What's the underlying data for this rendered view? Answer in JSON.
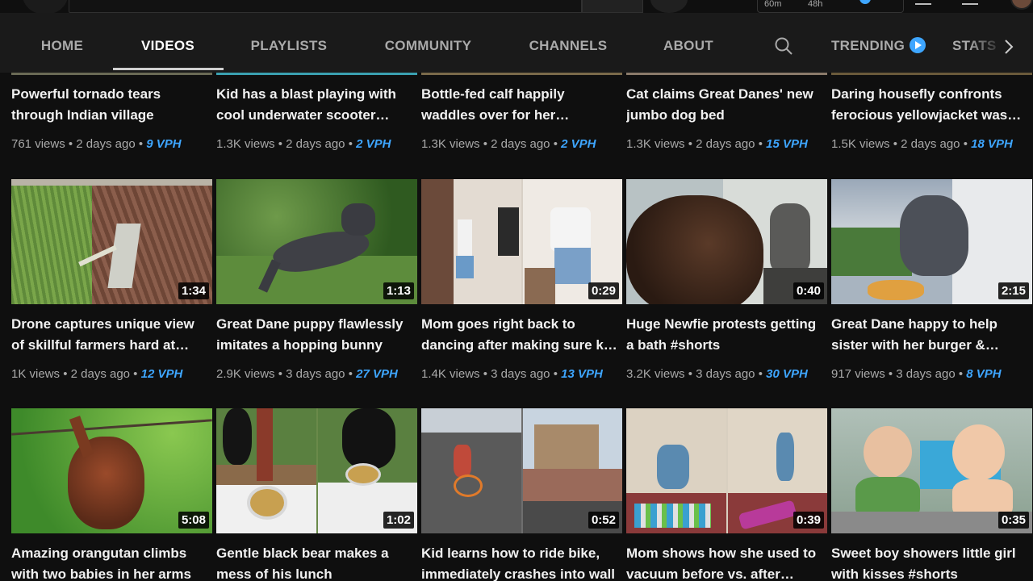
{
  "masthead": {
    "timer_left": "60m",
    "timer_right": "48h"
  },
  "tabs": {
    "items": [
      {
        "label": "HOME"
      },
      {
        "label": "VIDEOS"
      },
      {
        "label": "PLAYLISTS"
      },
      {
        "label": "COMMUNITY"
      },
      {
        "label": "CHANNELS"
      },
      {
        "label": "ABOUT"
      }
    ],
    "active": "VIDEOS",
    "extra": [
      {
        "label": "TRENDING"
      },
      {
        "label": "STATS"
      }
    ]
  },
  "colors": {
    "background": "#0f0f0f",
    "tab_bar": "#1a1a1a",
    "accent_vph": "#3ea6ff",
    "meta_text": "#aaaaaa"
  },
  "rows": [
    {
      "videos": [
        {
          "title1": "Powerful tornado tears",
          "title2": "through Indian village",
          "views": "761 views",
          "age": "2 days ago",
          "vph": "9 VPH"
        },
        {
          "title1": "Kid has a blast playing with",
          "title2": "cool underwater scooter…",
          "views": "1.3K views",
          "age": "2 days ago",
          "vph": "2 VPH"
        },
        {
          "title1": "Bottle-fed calf happily",
          "title2": "waddles over for her…",
          "views": "1.3K views",
          "age": "2 days ago",
          "vph": "2 VPH"
        },
        {
          "title1": "Cat claims Great Danes' new",
          "title2": "jumbo dog bed",
          "views": "1.3K views",
          "age": "2 days ago",
          "vph": "15 VPH"
        },
        {
          "title1": "Daring housefly confronts",
          "title2": "ferocious yellowjacket was…",
          "views": "1.5K views",
          "age": "2 days ago",
          "vph": "18 VPH"
        }
      ]
    },
    {
      "videos": [
        {
          "duration": "1:34",
          "title1": "Drone captures unique view",
          "title2": "of skillful farmers hard at…",
          "views": "1K views",
          "age": "2 days ago",
          "vph": "12 VPH",
          "thumb_icon": "farm-field-thumbnail"
        },
        {
          "duration": "1:13",
          "title1": "Great Dane puppy flawlessly",
          "title2": "imitates a hopping bunny",
          "views": "2.9K views",
          "age": "3 days ago",
          "vph": "27 VPH",
          "thumb_icon": "dog-jumping-thumbnail"
        },
        {
          "duration": "0:29",
          "title1": "Mom goes right back to",
          "title2": "dancing after making sure k…",
          "views": "1.4K views",
          "age": "3 days ago",
          "vph": "13 VPH",
          "thumb_icon": "family-dancing-thumbnail"
        },
        {
          "duration": "0:40",
          "title1": "Huge Newfie protests getting",
          "title2": "a bath #shorts",
          "views": "3.2K views",
          "age": "3 days ago",
          "vph": "30 VPH",
          "thumb_icon": "newfie-car-thumbnail"
        },
        {
          "duration": "2:15",
          "title1": "Great Dane happy to help",
          "title2": "sister with her burger &…",
          "views": "917 views",
          "age": "3 days ago",
          "vph": "8 VPH",
          "thumb_icon": "dane-car-window-thumbnail"
        }
      ]
    },
    {
      "videos": [
        {
          "duration": "5:08",
          "title1": "Amazing orangutan climbs",
          "title2": "with two babies in her arms",
          "thumb_icon": "orangutan-thumbnail"
        },
        {
          "duration": "1:02",
          "title1": "Gentle black bear makes a",
          "title2": "mess of his lunch",
          "thumb_icon": "black-bear-thumbnail"
        },
        {
          "duration": "0:52",
          "title1": "Kid learns how to ride bike,",
          "title2": "immediately crashes into wall",
          "thumb_icon": "kid-bike-thumbnail"
        },
        {
          "duration": "0:39",
          "title1": "Mom shows how she used to",
          "title2": "vacuum before vs. after…",
          "thumb_icon": "vacuum-thumbnail"
        },
        {
          "duration": "0:35",
          "title1": "Sweet boy showers little girl",
          "title2": "with kisses #shorts",
          "thumb_icon": "kids-kiss-thumbnail"
        }
      ]
    }
  ]
}
